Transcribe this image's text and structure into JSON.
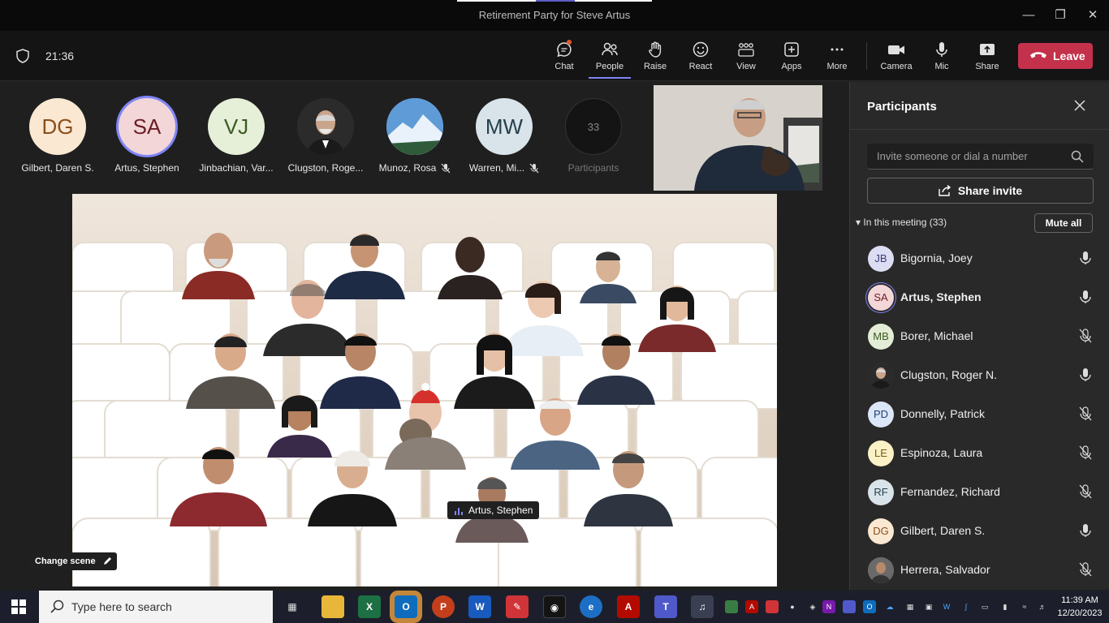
{
  "window": {
    "title": "Retirement Party for Steve Artus"
  },
  "toolbar": {
    "time": "21:36",
    "buttons": {
      "chat": "Chat",
      "people": "People",
      "raise": "Raise",
      "react": "React",
      "view": "View",
      "apps": "Apps",
      "more": "More",
      "camera": "Camera",
      "mic": "Mic",
      "share": "Share"
    },
    "leave": "Leave"
  },
  "gallery": {
    "avatars": [
      {
        "initials": "DG",
        "name": "Gilbert, Daren S.",
        "bg": "#fbe8d2",
        "fg": "#8a4f1c"
      },
      {
        "initials": "SA",
        "name": "Artus, Stephen",
        "bg": "#f3d6d8",
        "fg": "#6b1d24"
      },
      {
        "initials": "VJ",
        "name": "Jinbachian, Var...",
        "bg": "#e6efd8",
        "fg": "#3d5a22"
      },
      {
        "initials": "",
        "name": "Clugston, Roge...",
        "bg": "#3a3a3a",
        "fg": "#fff"
      },
      {
        "initials": "",
        "name": "Munoz, Rosa",
        "bg": "#6aa0d8",
        "fg": "#fff"
      },
      {
        "initials": "MW",
        "name": "Warren, Mi...",
        "bg": "#d9e4ea",
        "fg": "#26404d"
      }
    ],
    "overflow_count": "33",
    "overflow_label": "Participants"
  },
  "stage": {
    "change_scene": "Change scene",
    "speaker": "Artus, Stephen"
  },
  "panel": {
    "title": "Participants",
    "invite_placeholder": "Invite someone or dial a number",
    "share_invite": "Share invite",
    "section": "In this meeting (33)",
    "mute_all": "Mute all",
    "participants": [
      {
        "initials": "JB",
        "name": "Bigornia, Joey",
        "bg": "#dcdcf2",
        "fg": "#3a3a7a",
        "mic": "on"
      },
      {
        "initials": "SA",
        "name": "Artus, Stephen",
        "bg": "#f3d6d8",
        "fg": "#6b1d24",
        "mic": "on"
      },
      {
        "initials": "MB",
        "name": "Borer, Michael",
        "bg": "#e3edd6",
        "fg": "#3d5a22",
        "mic": "muted"
      },
      {
        "initials": "",
        "name": "Clugston, Roger N.",
        "bg": "#3a3a3a",
        "fg": "#fff",
        "mic": "on"
      },
      {
        "initials": "PD",
        "name": "Donnelly, Patrick",
        "bg": "#dbe6f7",
        "fg": "#1f3f73",
        "mic": "muted"
      },
      {
        "initials": "LE",
        "name": "Espinoza, Laura",
        "bg": "#fbf1c7",
        "fg": "#7a5b08",
        "mic": "muted"
      },
      {
        "initials": "RF",
        "name": "Fernandez, Richard",
        "bg": "#d9e4ea",
        "fg": "#26404d",
        "mic": "muted"
      },
      {
        "initials": "DG",
        "name": "Gilbert, Daren S.",
        "bg": "#fbe8d2",
        "fg": "#8a4f1c",
        "mic": "on"
      },
      {
        "initials": "",
        "name": "Herrera, Salvador",
        "bg": "#7a7a7a",
        "fg": "#fff",
        "mic": "muted"
      }
    ]
  },
  "taskbar": {
    "search_placeholder": "Type here to search",
    "time": "11:39 AM",
    "date": "12/20/2023"
  }
}
